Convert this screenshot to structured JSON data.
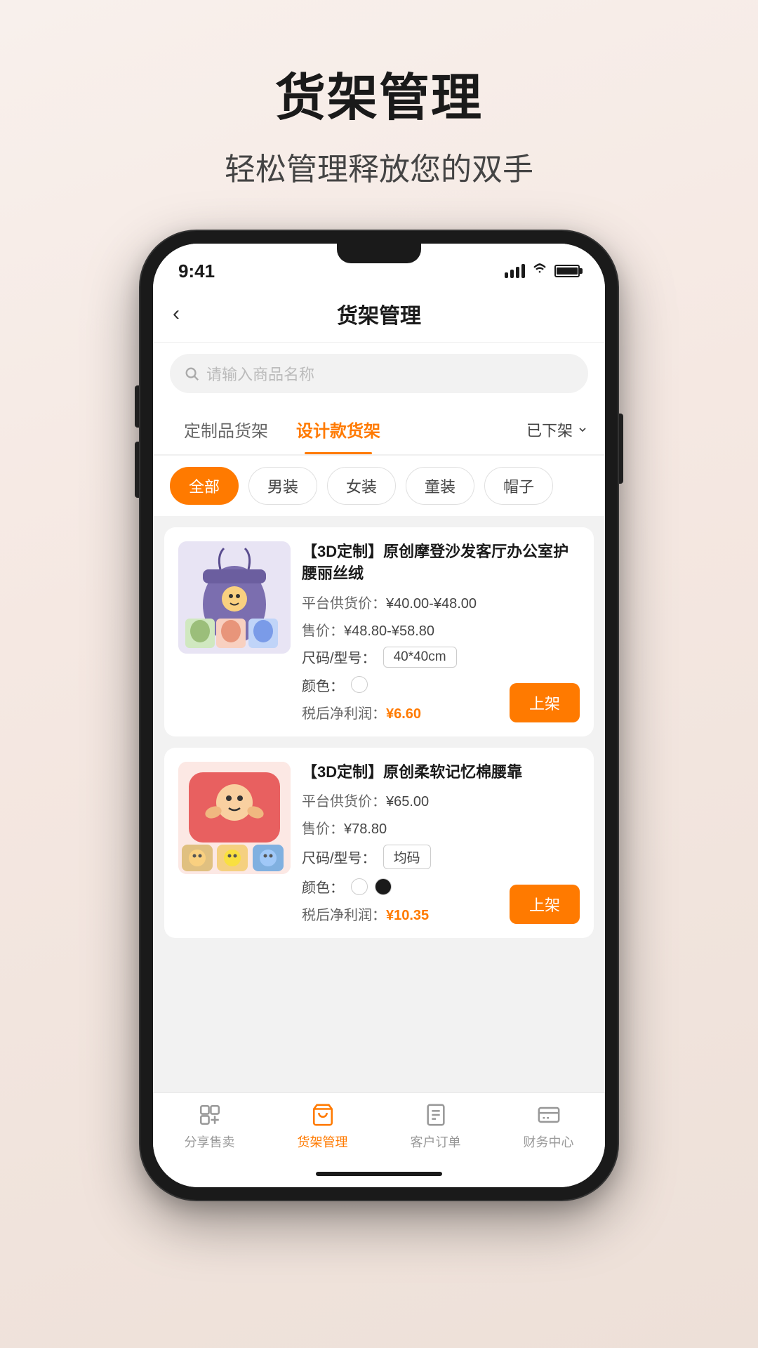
{
  "hero": {
    "title": "货架管理",
    "subtitle": "轻松管理释放您的双手"
  },
  "phone": {
    "statusBar": {
      "time": "9:41"
    },
    "navBar": {
      "backIcon": "‹",
      "title": "货架管理"
    },
    "searchBar": {
      "placeholder": "请输入商品名称"
    },
    "tabs": [
      {
        "label": "定制品货架",
        "active": false
      },
      {
        "label": "设计款货架",
        "active": true
      }
    ],
    "filterLabel": "已下架",
    "chips": [
      {
        "label": "全部",
        "active": true
      },
      {
        "label": "男装",
        "active": false
      },
      {
        "label": "女装",
        "active": false
      },
      {
        "label": "童装",
        "active": false
      },
      {
        "label": "帽子",
        "active": false
      }
    ],
    "products": [
      {
        "id": 1,
        "title": "【3D定制】原创摩登沙发客厅办公室护腰丽丝绒",
        "supplyPriceLabel": "平台供货价：",
        "supplyPrice": "¥40.00-¥48.00",
        "salePriceLabel": "售价：",
        "salePrice": "¥48.80-¥58.80",
        "sizeLabel": "尺码/型号：",
        "sizeTag": "40*40cm",
        "colorLabel": "颜色：",
        "colors": [
          "white"
        ],
        "profitLabel": "税后净利润：",
        "profitValue": "¥6.60",
        "buttonLabel": "上架"
      },
      {
        "id": 2,
        "title": "【3D定制】原创柔软记忆棉腰靠",
        "supplyPriceLabel": "平台供货价：",
        "supplyPrice": "¥65.00",
        "salePriceLabel": "售价：",
        "salePrice": "¥78.80",
        "sizeLabel": "尺码/型号：",
        "sizeTag": "均码",
        "colorLabel": "颜色：",
        "colors": [
          "white",
          "black"
        ],
        "profitLabel": "税后净利润：",
        "profitValue": "¥10.35",
        "buttonLabel": "上架"
      }
    ],
    "bottomNav": [
      {
        "label": "分享售卖",
        "icon": "share",
        "active": false
      },
      {
        "label": "货架管理",
        "icon": "shelf",
        "active": true
      },
      {
        "label": "客户订单",
        "icon": "order",
        "active": false
      },
      {
        "label": "财务中心",
        "icon": "finance",
        "active": false
      }
    ]
  }
}
